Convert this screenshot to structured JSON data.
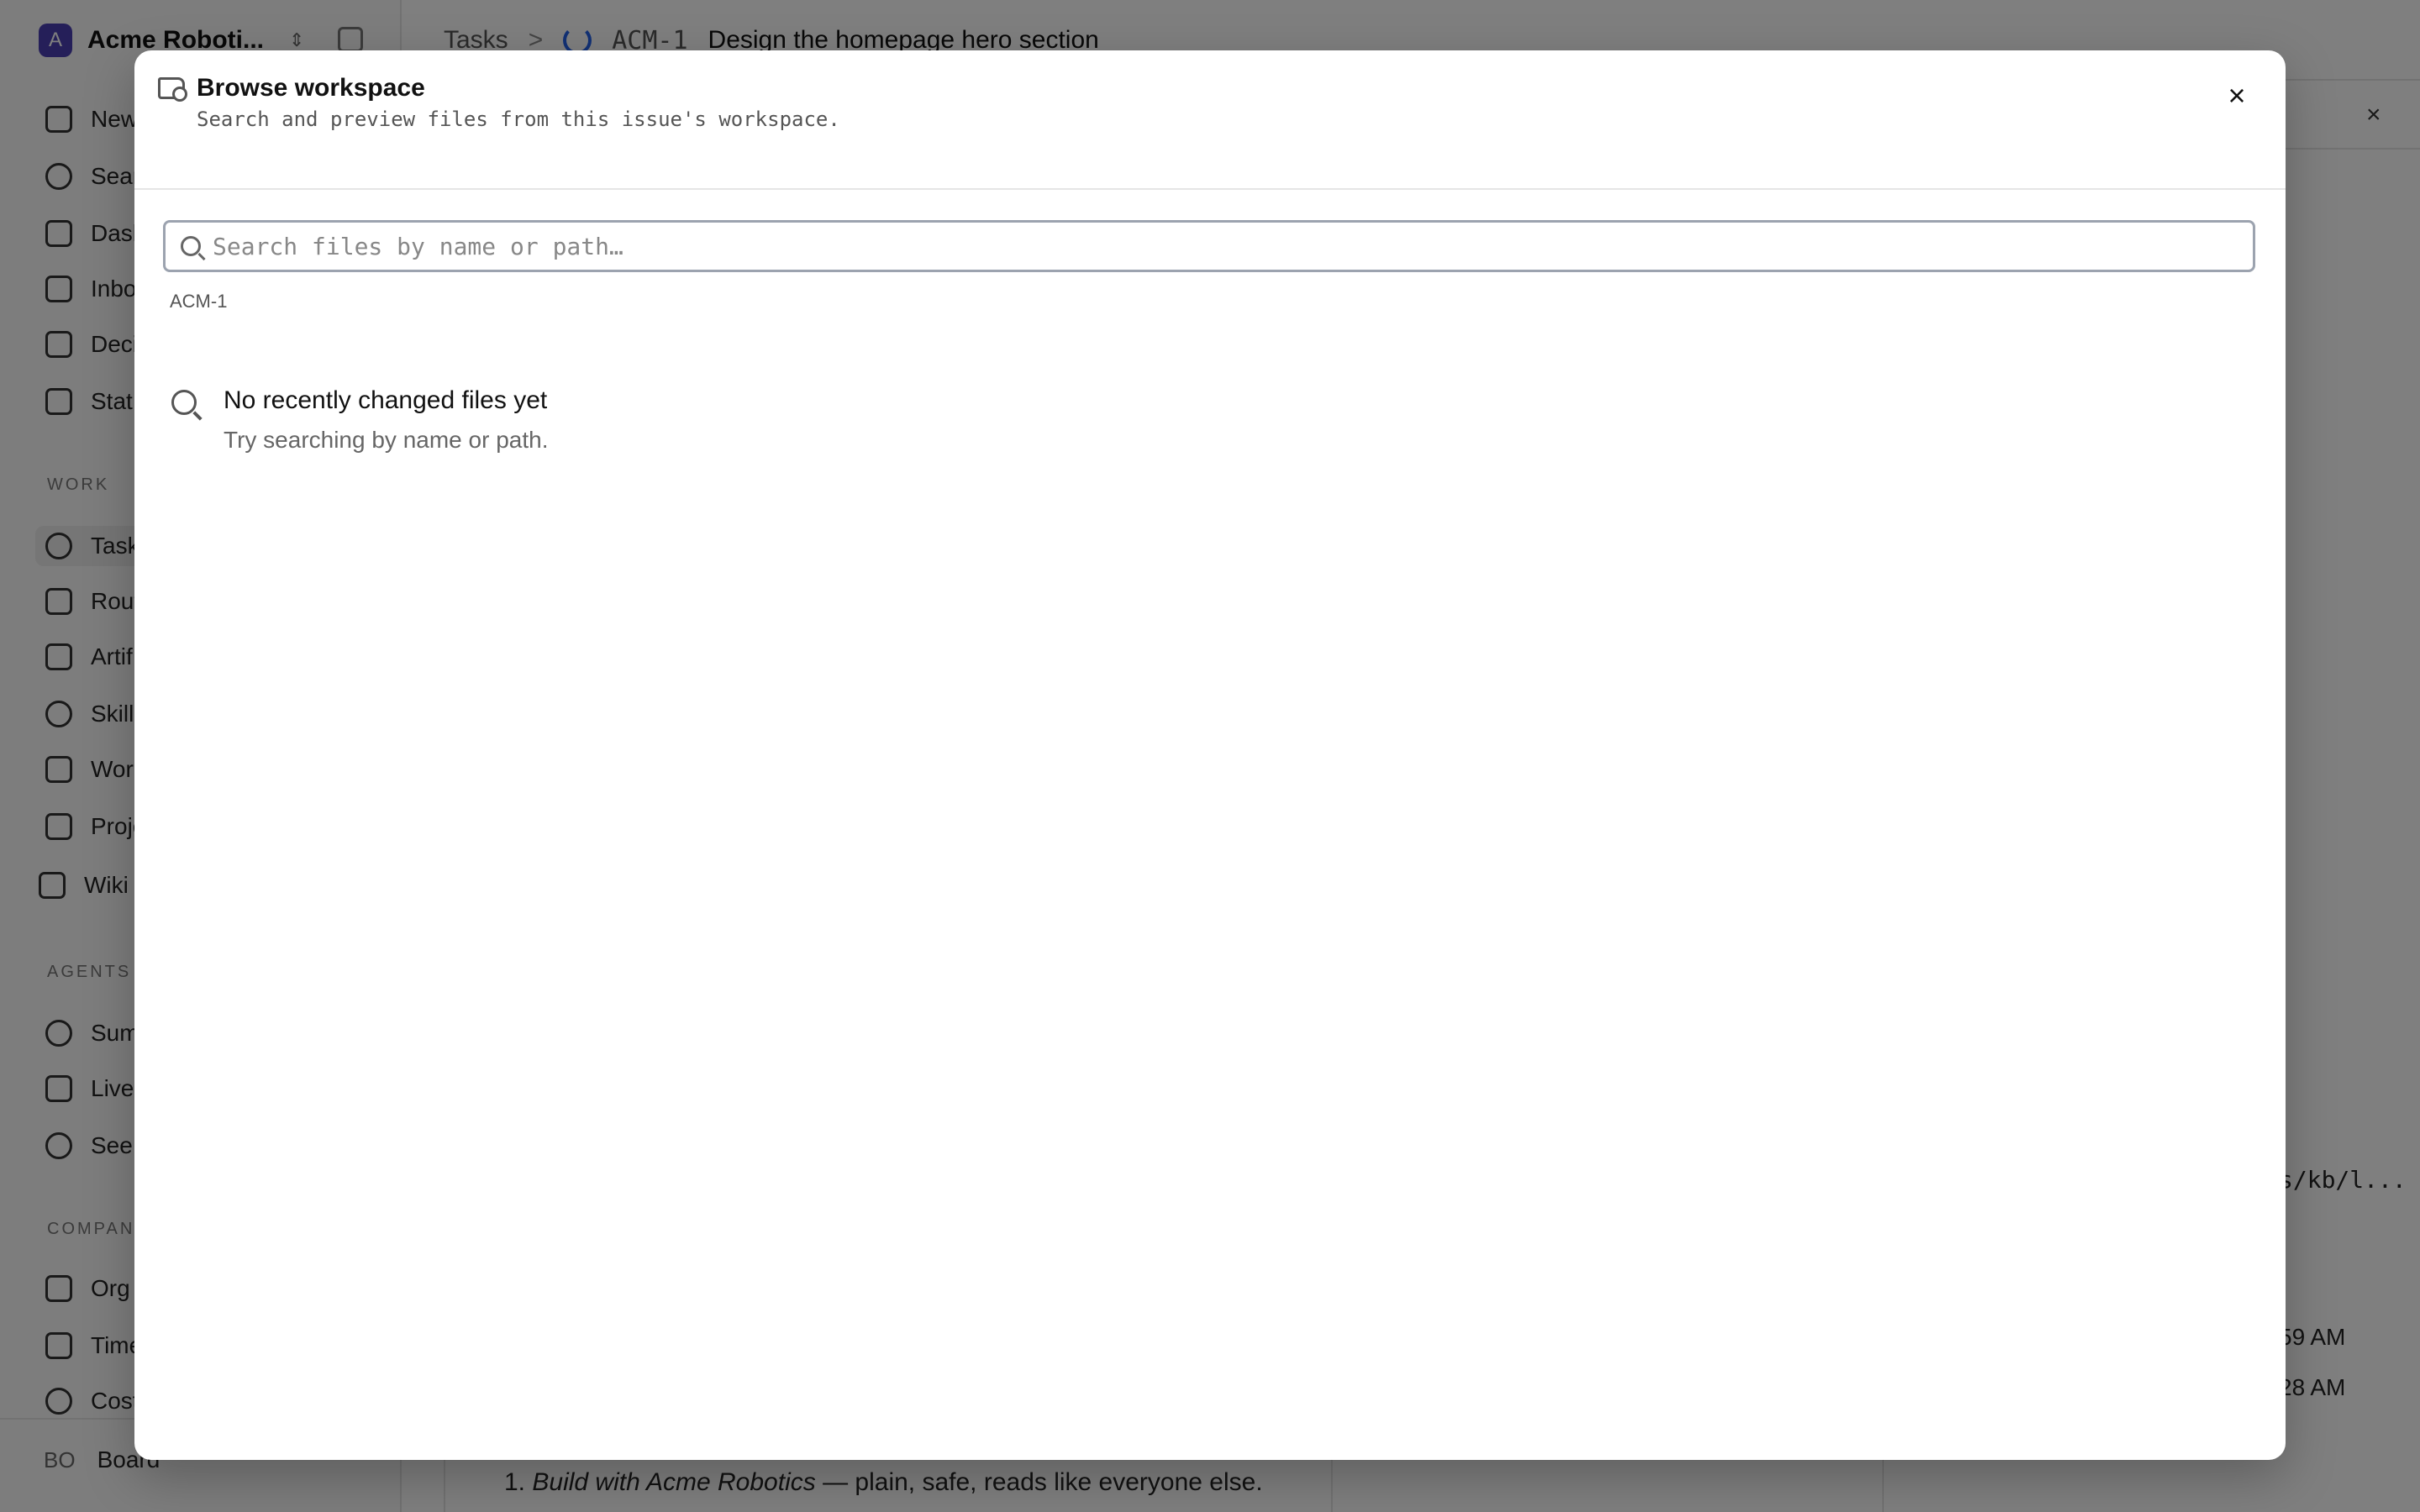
{
  "workspace": {
    "avatar_initial": "A",
    "name": "Acme Roboti...",
    "color": "#4b3fb3"
  },
  "nav_top": [
    {
      "label": "New"
    },
    {
      "label": "Sear"
    },
    {
      "label": "Dash"
    },
    {
      "label": "Inbo"
    },
    {
      "label": "Deci"
    },
    {
      "label": "Stat"
    }
  ],
  "sections": {
    "work": "WORK",
    "agents": "AGENTS",
    "company": "COMPANY"
  },
  "nav_work": [
    {
      "label": "Task"
    },
    {
      "label": "Rout"
    },
    {
      "label": "Artif"
    },
    {
      "label": "Skill"
    },
    {
      "label": "Wor"
    },
    {
      "label": "Proje"
    },
    {
      "label": "Wiki"
    }
  ],
  "nav_agents": [
    {
      "label": "Sum"
    },
    {
      "label": "Live"
    },
    {
      "label": "See"
    }
  ],
  "nav_company": [
    {
      "label": "Org"
    },
    {
      "label": "Time"
    },
    {
      "label": "Cost"
    }
  ],
  "user": {
    "initials": "BO",
    "label": "Board"
  },
  "breadcrumb": {
    "tasks": "Tasks",
    "separator": ">",
    "issue_id": "ACM-1",
    "issue_title": "Design the homepage hero section"
  },
  "right_panel": {
    "close": "×",
    "path_fragment": "s/kb/l...",
    "time1": "59 AM",
    "time2": "28 AM"
  },
  "content_line": {
    "number": "1.",
    "italic": "Build with Acme Robotics",
    "rest": " — plain, safe, reads like everyone else."
  },
  "dialog": {
    "title": "Browse workspace",
    "subtitle": "Search and preview files from this issue's workspace.",
    "close": "×",
    "search_placeholder": "Search files by name or path…",
    "scope": "ACM-1",
    "empty_title": "No recently changed files yet",
    "empty_hint": "Try searching by name or path."
  }
}
